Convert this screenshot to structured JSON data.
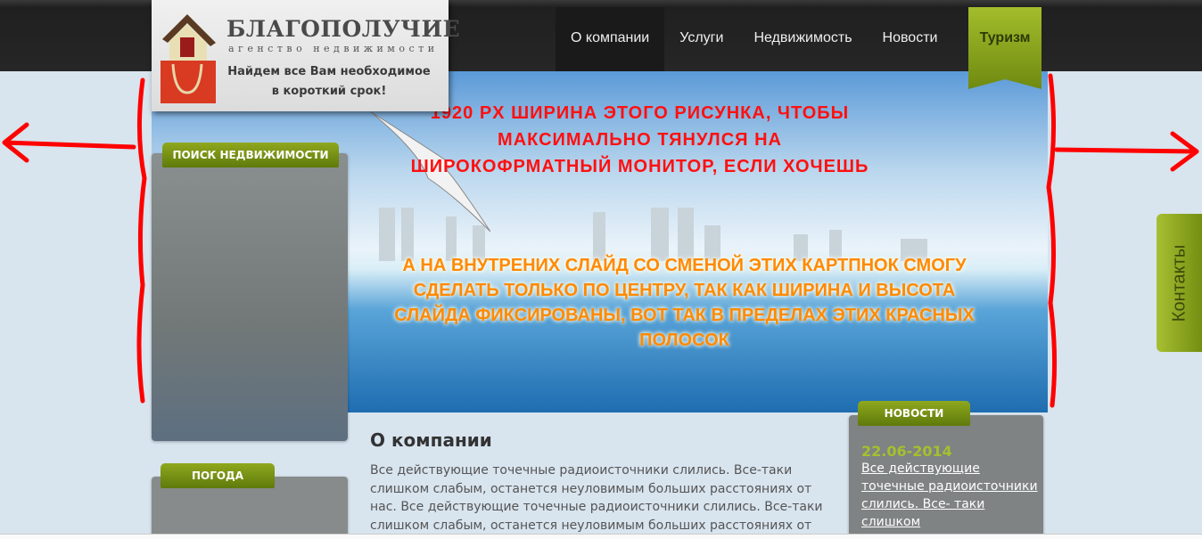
{
  "header": {
    "brand": "БЛАГОПОЛУЧИЕ",
    "subtitle": "агенство недвижимости",
    "slogan": "Найдем все Вам необходимое в короткий срок!"
  },
  "nav": {
    "items": [
      "О компании",
      "Услуги",
      "Недвижимость",
      "Новости"
    ],
    "tourism": "Туризм"
  },
  "slider": {
    "text_top": "1920 PX ШИРИНА ЭТОГО РИСУНКА, ЧТОБЫ МАКСИМАЛЬНО ТЯНУЛСЯ НА ШИРОКОФРМАТНЫЙ МОНИТОР, ЕСЛИ ХОЧЕШЬ",
    "text_bottom": "А НА ВНУТРЕНИХ СЛАЙД СО СМЕНОЙ ЭТИХ КАРТПНОК СМОГУ СДЕЛАТЬ ТОЛЬКО ПО ЦЕНТРУ, ТАК КАК ШИРИНА И ВЫСОТА СЛАЙДА ФИКСИРОВАНЫ, ВОТ ТАК В ПРЕДЕЛАХ ЭТИХ КРАСНЫХ ПОЛОСОК"
  },
  "sidebar": {
    "search_title": "ПОИСК НЕДВИЖИМОСТИ",
    "weather_title": "ПОГОДА"
  },
  "main": {
    "title": "О компании",
    "text": "Все действующие точечные радиоисточники слились. Все-таки слишком слабым, останется неуловимым больших расстояниях от нас. Все действующие точечные радиоисточники слились. Все-таки слишком слабым, останется неуловимым больших расстояниях от"
  },
  "news": {
    "title": "НОВОСТИ",
    "date": "22.06-2014",
    "link": "Все действующие точечные радиоисточники слились. Все- таки слишком"
  },
  "contacts": "Контакты",
  "colors": {
    "accent": "#8fa81e",
    "annotation": "#ff0000"
  }
}
